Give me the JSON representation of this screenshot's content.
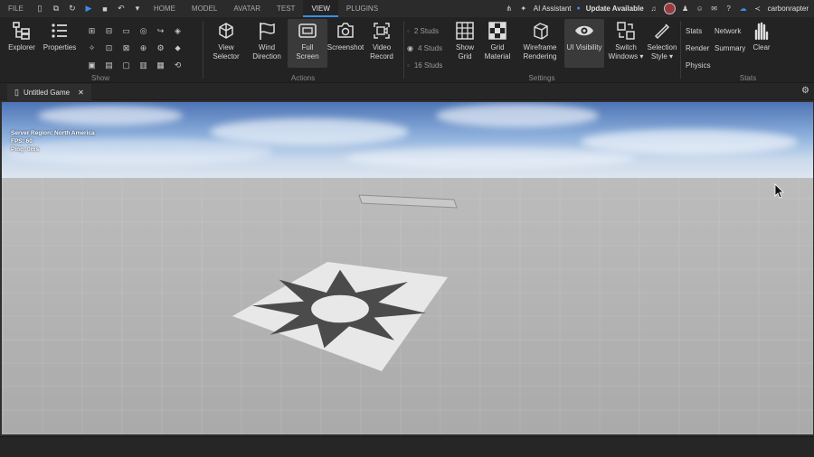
{
  "topbar": {
    "file_label": "FILE",
    "tabs": [
      "HOME",
      "MODEL",
      "AVATAR",
      "TEST",
      "VIEW",
      "PLUGINS"
    ],
    "active_tab": "VIEW",
    "ai_assistant": "AI Assistant",
    "update_available": "Update Available",
    "username": "carbonrapter"
  },
  "ribbon": {
    "show": {
      "explorer": "Explorer",
      "properties": "Properties",
      "label": "Show"
    },
    "actions": {
      "view_selector": [
        "View",
        "Selector"
      ],
      "wind_direction": [
        "Wind",
        "Direction"
      ],
      "full_screen": [
        "Full",
        "Screen"
      ],
      "screenshot": "Screenshot",
      "video_record": [
        "Video",
        "Record"
      ],
      "label": "Actions"
    },
    "settings": {
      "studs": [
        "2 Studs",
        "4 Studs",
        "16 Studs"
      ],
      "show_grid": [
        "Show",
        "Grid"
      ],
      "grid_material": [
        "Grid",
        "Material"
      ],
      "wireframe_rendering": [
        "Wireframe",
        "Rendering"
      ],
      "ui_visibility": "UI Visibility",
      "switch_windows": [
        "Switch",
        "Windows ▾"
      ],
      "selection_style": [
        "Selection",
        "Style ▾"
      ],
      "label": "Settings"
    },
    "stats": {
      "col1": [
        "Stats",
        "Render",
        "Physics"
      ],
      "col2": [
        "Network",
        "Summary"
      ],
      "clear": "Clear",
      "label": "Stats"
    }
  },
  "document_tab": {
    "title": "Untitled Game"
  },
  "viewport": {
    "stats_overlay": [
      "Server Region: North America",
      "FPS: 60",
      "Ping: 0ms"
    ]
  },
  "colors": {
    "accent": "#3b8de8",
    "background": "#2e2e2e"
  }
}
